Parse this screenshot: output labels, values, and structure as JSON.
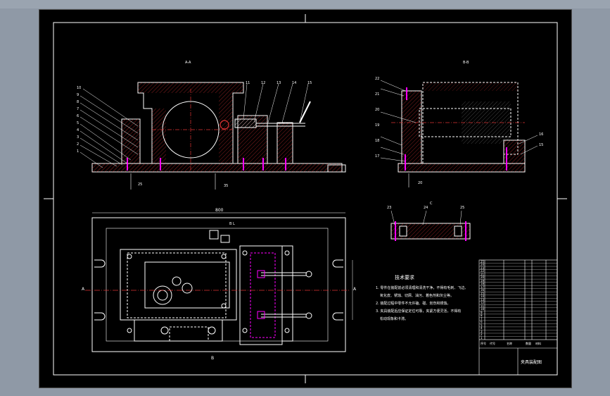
{
  "drawing": {
    "views": {
      "section_a": "A-A",
      "section_b": "B-B",
      "view_c": "C"
    },
    "dims": {
      "overall_width": "800",
      "left_base": "25",
      "right_base": "35",
      "height": "20"
    },
    "balloons_left": [
      "10",
      "9",
      "8",
      "7",
      "6",
      "5",
      "4",
      "3",
      "2",
      "1"
    ],
    "balloons_top": [
      "11",
      "12",
      "13",
      "14",
      "15"
    ],
    "balloons_right_a": [
      "22",
      "21",
      "20",
      "19",
      "18",
      "17"
    ],
    "balloons_right_b": [
      "16",
      "15"
    ],
    "balloons_c": [
      "23",
      "24",
      "25"
    ],
    "plan_labels": {
      "a_left": "A",
      "a_right": "A",
      "b_label": "B",
      "section_marks": "B L"
    },
    "notes": {
      "title": "技术要求",
      "lines": [
        "1. 零件在装配前必须清理和清洗干净，不得有毛刺、飞边、",
        "氧化皮、锈蚀、切屑、油污、着色剂和灰尘等。",
        "2. 装配过程中零件不允许磕、碰、划伤和锈蚀。",
        "3. 夹具装配后应保证定位可靠，夹紧方便灵活，不得有",
        "松动现象和卡滞。"
      ]
    },
    "title_block": {
      "rows": [
        "25",
        "24",
        "23",
        "22",
        "21",
        "20",
        "19",
        "18",
        "17",
        "16",
        "15",
        "14",
        "13",
        "12",
        "11",
        "10",
        "9",
        "8",
        "7",
        "6",
        "5",
        "4",
        "3",
        "2",
        "1"
      ],
      "header": [
        "序号",
        "代号",
        "名称",
        "数量",
        "材料"
      ],
      "footer": "夹具装配图"
    }
  }
}
